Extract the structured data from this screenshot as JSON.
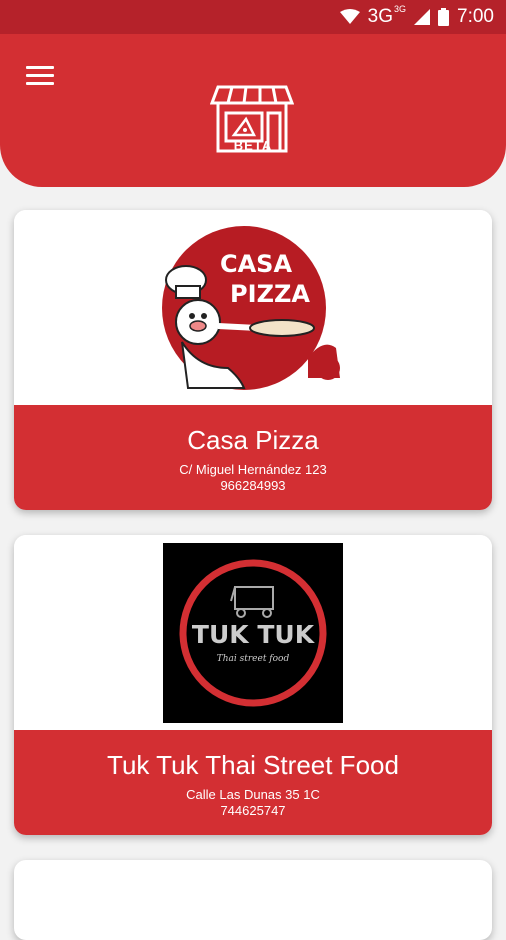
{
  "status_bar": {
    "network": "3G",
    "network_sup": "3G",
    "time": "7:00",
    "icons": [
      "wifi-icon",
      "signal-icon",
      "battery-icon"
    ]
  },
  "header": {
    "badge": "BETA",
    "menu_icon": "hamburger-menu-icon",
    "logo_icon": "storefront-pizza-icon"
  },
  "restaurants": [
    {
      "name": "Casa Pizza",
      "address": "C/ Miguel Hernández 123",
      "phone": "966284993",
      "logo_text_1": "CASA",
      "logo_text_2": "PIZZA"
    },
    {
      "name": "Tuk Tuk Thai Street Food",
      "address": "Calle Las Dunas 35 1C",
      "phone": "744625747",
      "logo_text_1": "TUK TUK",
      "logo_text_2": "Thai street food"
    }
  ],
  "colors": {
    "primary": "#d32f33",
    "status_bar": "#b5222a",
    "background": "#f2f2f2"
  }
}
